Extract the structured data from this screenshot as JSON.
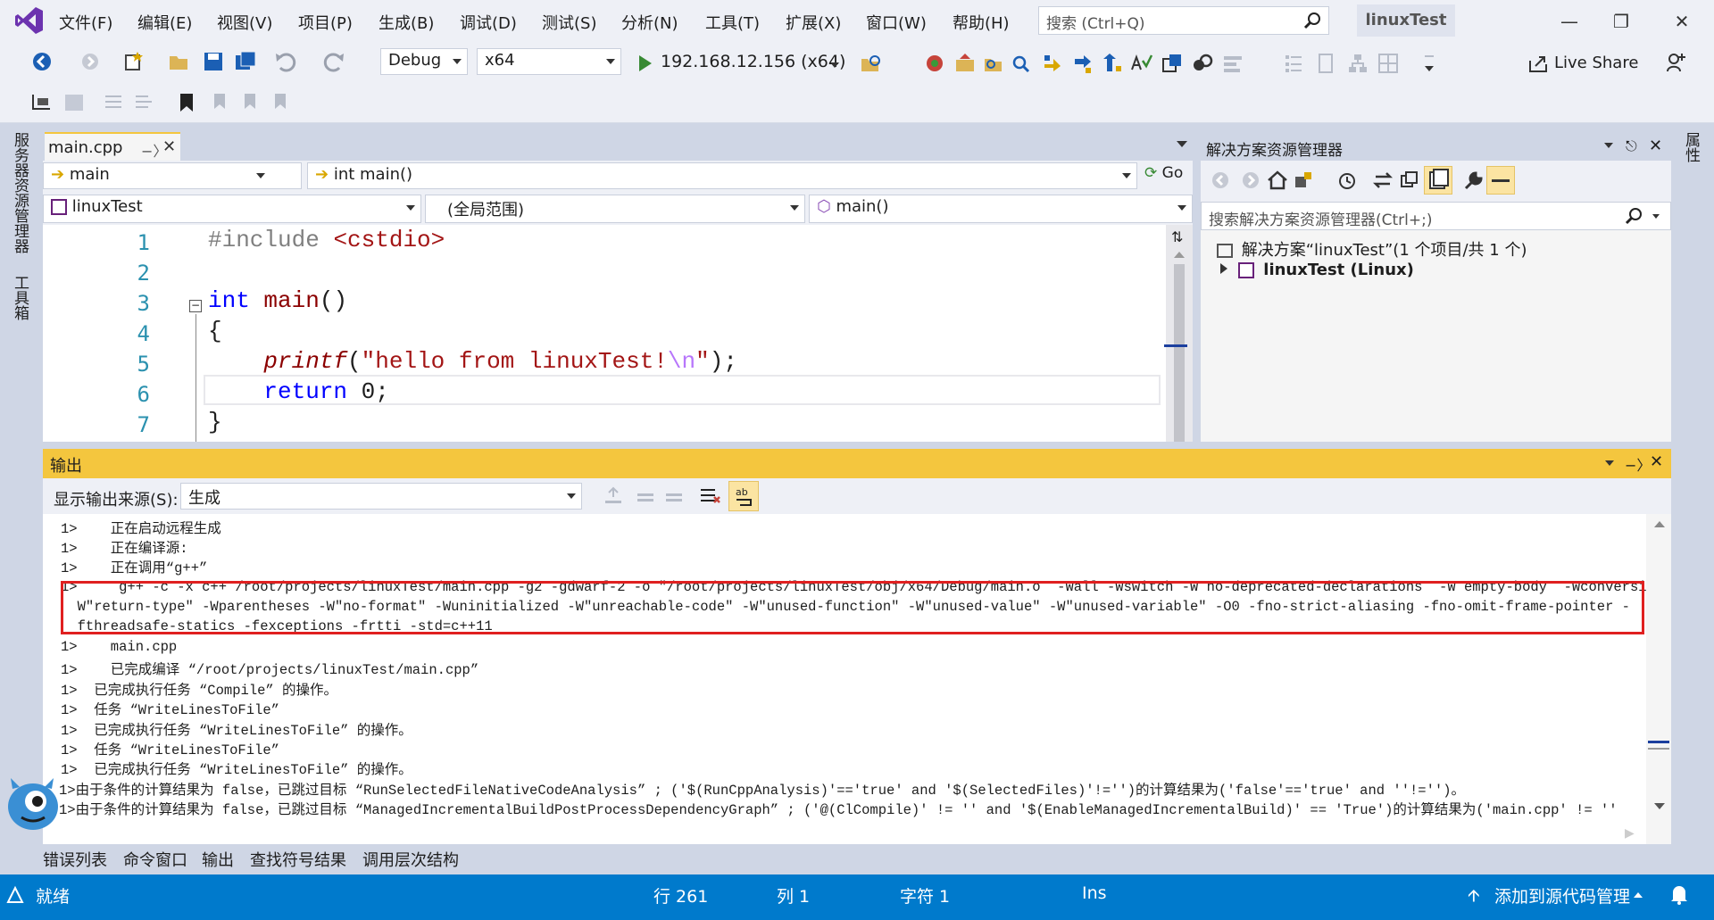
{
  "titlebar": {
    "menu": [
      "文件(F)",
      "编辑(E)",
      "视图(V)",
      "项目(P)",
      "生成(B)",
      "调试(D)",
      "测试(S)",
      "分析(N)",
      "工具(T)",
      "扩展(X)",
      "窗口(W)",
      "帮助(H)"
    ],
    "search_placeholder": "搜索 (Ctrl+Q)",
    "solution_name": "linuxTest"
  },
  "toolbar": {
    "config": "Debug",
    "platform": "x64",
    "run_target": "192.168.12.156 (x64)",
    "live_share": "Live Share"
  },
  "left_strip": {
    "server_explorer": "服务器资源管理器",
    "toolbox": "工具箱"
  },
  "right_strip": {
    "properties": "属性"
  },
  "editor": {
    "tab_label": "main.cpp",
    "nav_scope": "main",
    "nav_member": "int main()",
    "go_label": "Go",
    "project_combo": "linuxTest",
    "scope_combo": "(全局范围)",
    "function_combo": "main()",
    "line_numbers": [
      "1",
      "2",
      "3",
      "4",
      "5",
      "6",
      "7"
    ]
  },
  "solution_explorer": {
    "title": "解决方案资源管理器",
    "search_placeholder": "搜索解决方案资源管理器(Ctrl+;)",
    "solution_node": "解决方案“linuxTest”(1 个项目/共 1 个)",
    "project_node": "linuxTest (Linux)"
  },
  "output": {
    "title": "输出",
    "source_label": "显示输出来源(S):",
    "source_value": "生成",
    "lines": [
      "1>    正在启动远程生成",
      "1>    正在编译源:",
      "1>    正在调用“g++”",
      "1>     g++ -c -x c++ /root/projects/linuxTest/main.cpp -g2 -gdwarf-2 -o \"/root/projects/linuxTest/obj/x64/Debug/main.o  -Wall -Wswitch -W no-deprecated-declarations  -W empty-body  -Wconversion -",
      "  W\"return-type\" -Wparentheses -W\"no-format\" -Wuninitialized -W\"unreachable-code\" -W\"unused-function\" -W\"unused-value\" -W\"unused-variable\" -O0 -fno-strict-aliasing -fno-omit-frame-pointer -",
      "  fthreadsafe-statics -fexceptions -frtti -std=c++11",
      "1>    main.cpp",
      "1>    已完成编译 “/root/projects/linuxTest/main.cpp”",
      "1>  已完成执行任务 “Compile” 的操作。",
      "1>  任务 “WriteLinesToFile”",
      "1>  已完成执行任务 “WriteLinesToFile” 的操作。",
      "1>  任务 “WriteLinesToFile”",
      "1>  已完成执行任务 “WriteLinesToFile” 的操作。",
      "1>由于条件的计算结果为 false，已跳过目标 “RunSelectedFileNativeCodeAnalysis” ; ('$(RunCppAnalysis)'=='true' and '$(SelectedFiles)'!='')的计算结果为('false'=='true' and ''!='')。",
      "1>由于条件的计算结果为 false，已跳过目标 “ManagedIncrementalBuildPostProcessDependencyGraph” ; ('@(ClCompile)' != '' and '$(EnableManagedIncrementalBuild)' == 'True')的计算结果为('main.cpp' != ''"
    ]
  },
  "bottom_tabs": [
    "错误列表",
    "命令窗口",
    "输出",
    "查找符号结果",
    "调用层次结构"
  ],
  "statusbar": {
    "ready": "就绪",
    "line": "行 261",
    "col": "列 1",
    "char": "字符 1",
    "ins": "Ins",
    "source_control": "添加到源代码管理"
  },
  "colors": {
    "accent": "#007acc",
    "tab_active": "#f4c63e",
    "highlight_box": "#e02020"
  }
}
